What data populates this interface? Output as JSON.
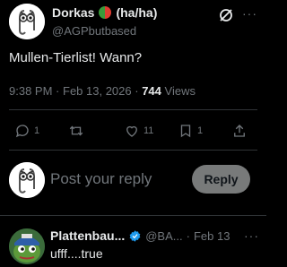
{
  "tweet": {
    "author_name": "Dorkas",
    "author_suffix": "(ha/ha)",
    "author_handle": "@AGPbutbased",
    "text": "Mullen-Tierlist! Wann?",
    "time": "9:38 PM",
    "date": "Feb 13, 2026",
    "views_count": "744",
    "views_label": "Views",
    "replies": "1",
    "retweets": "",
    "likes": "11",
    "bookmarks": "1"
  },
  "composer": {
    "placeholder": "Post your reply",
    "reply_label": "Reply"
  },
  "reply": {
    "author_name": "Plattenbau...",
    "author_handle": "@BA...",
    "date": "Feb 13",
    "text": "ufff....true"
  },
  "colors": {
    "background": "#000000",
    "text": "#e7e9ea",
    "muted": "#71767b",
    "divider": "#2f3336",
    "verified": "#1d9bf0"
  }
}
